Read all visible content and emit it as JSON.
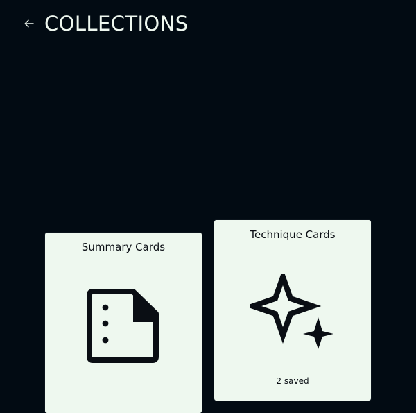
{
  "header": {
    "title": "COLLECTIONS",
    "back_icon": "arrow-left-icon"
  },
  "colors": {
    "background": "#020b13",
    "card": "#eef8ef",
    "text_dark": "#0a0e14",
    "text_light": "#eef7ef"
  },
  "collections": [
    {
      "title": "Summary Cards",
      "icon": "document-list-icon",
      "count_text": ""
    },
    {
      "title": "Technique Cards",
      "icon": "sparkles-icon",
      "count_text": "2 saved"
    }
  ]
}
